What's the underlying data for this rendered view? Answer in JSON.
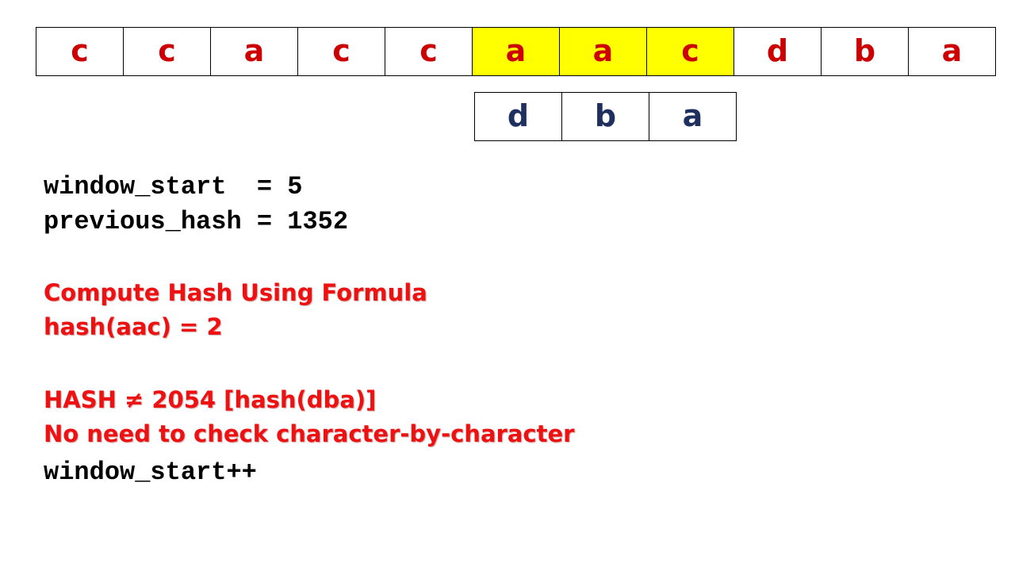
{
  "text_chars": [
    "c",
    "c",
    "a",
    "c",
    "c",
    "a",
    "a",
    "c",
    "d",
    "b",
    "a"
  ],
  "highlighted_indices": [
    5,
    6,
    7
  ],
  "pattern_chars": [
    "d",
    "b",
    "a"
  ],
  "code_lines": {
    "window_start": "window_start  = 5",
    "previous_hash": "previous_hash = 1352",
    "increment": "window_start++"
  },
  "notes": {
    "compute_title": "Compute Hash Using Formula",
    "hash_value": "hash(aac) = 2",
    "comparison": "HASH ≠ 2054 [hash(dba)]",
    "no_check": "No need to check character-by-character"
  },
  "colors": {
    "text_char": "#cc0000",
    "pattern_char": "#1f2f5f",
    "highlight": "#ffff00",
    "note": "#ee1111"
  }
}
